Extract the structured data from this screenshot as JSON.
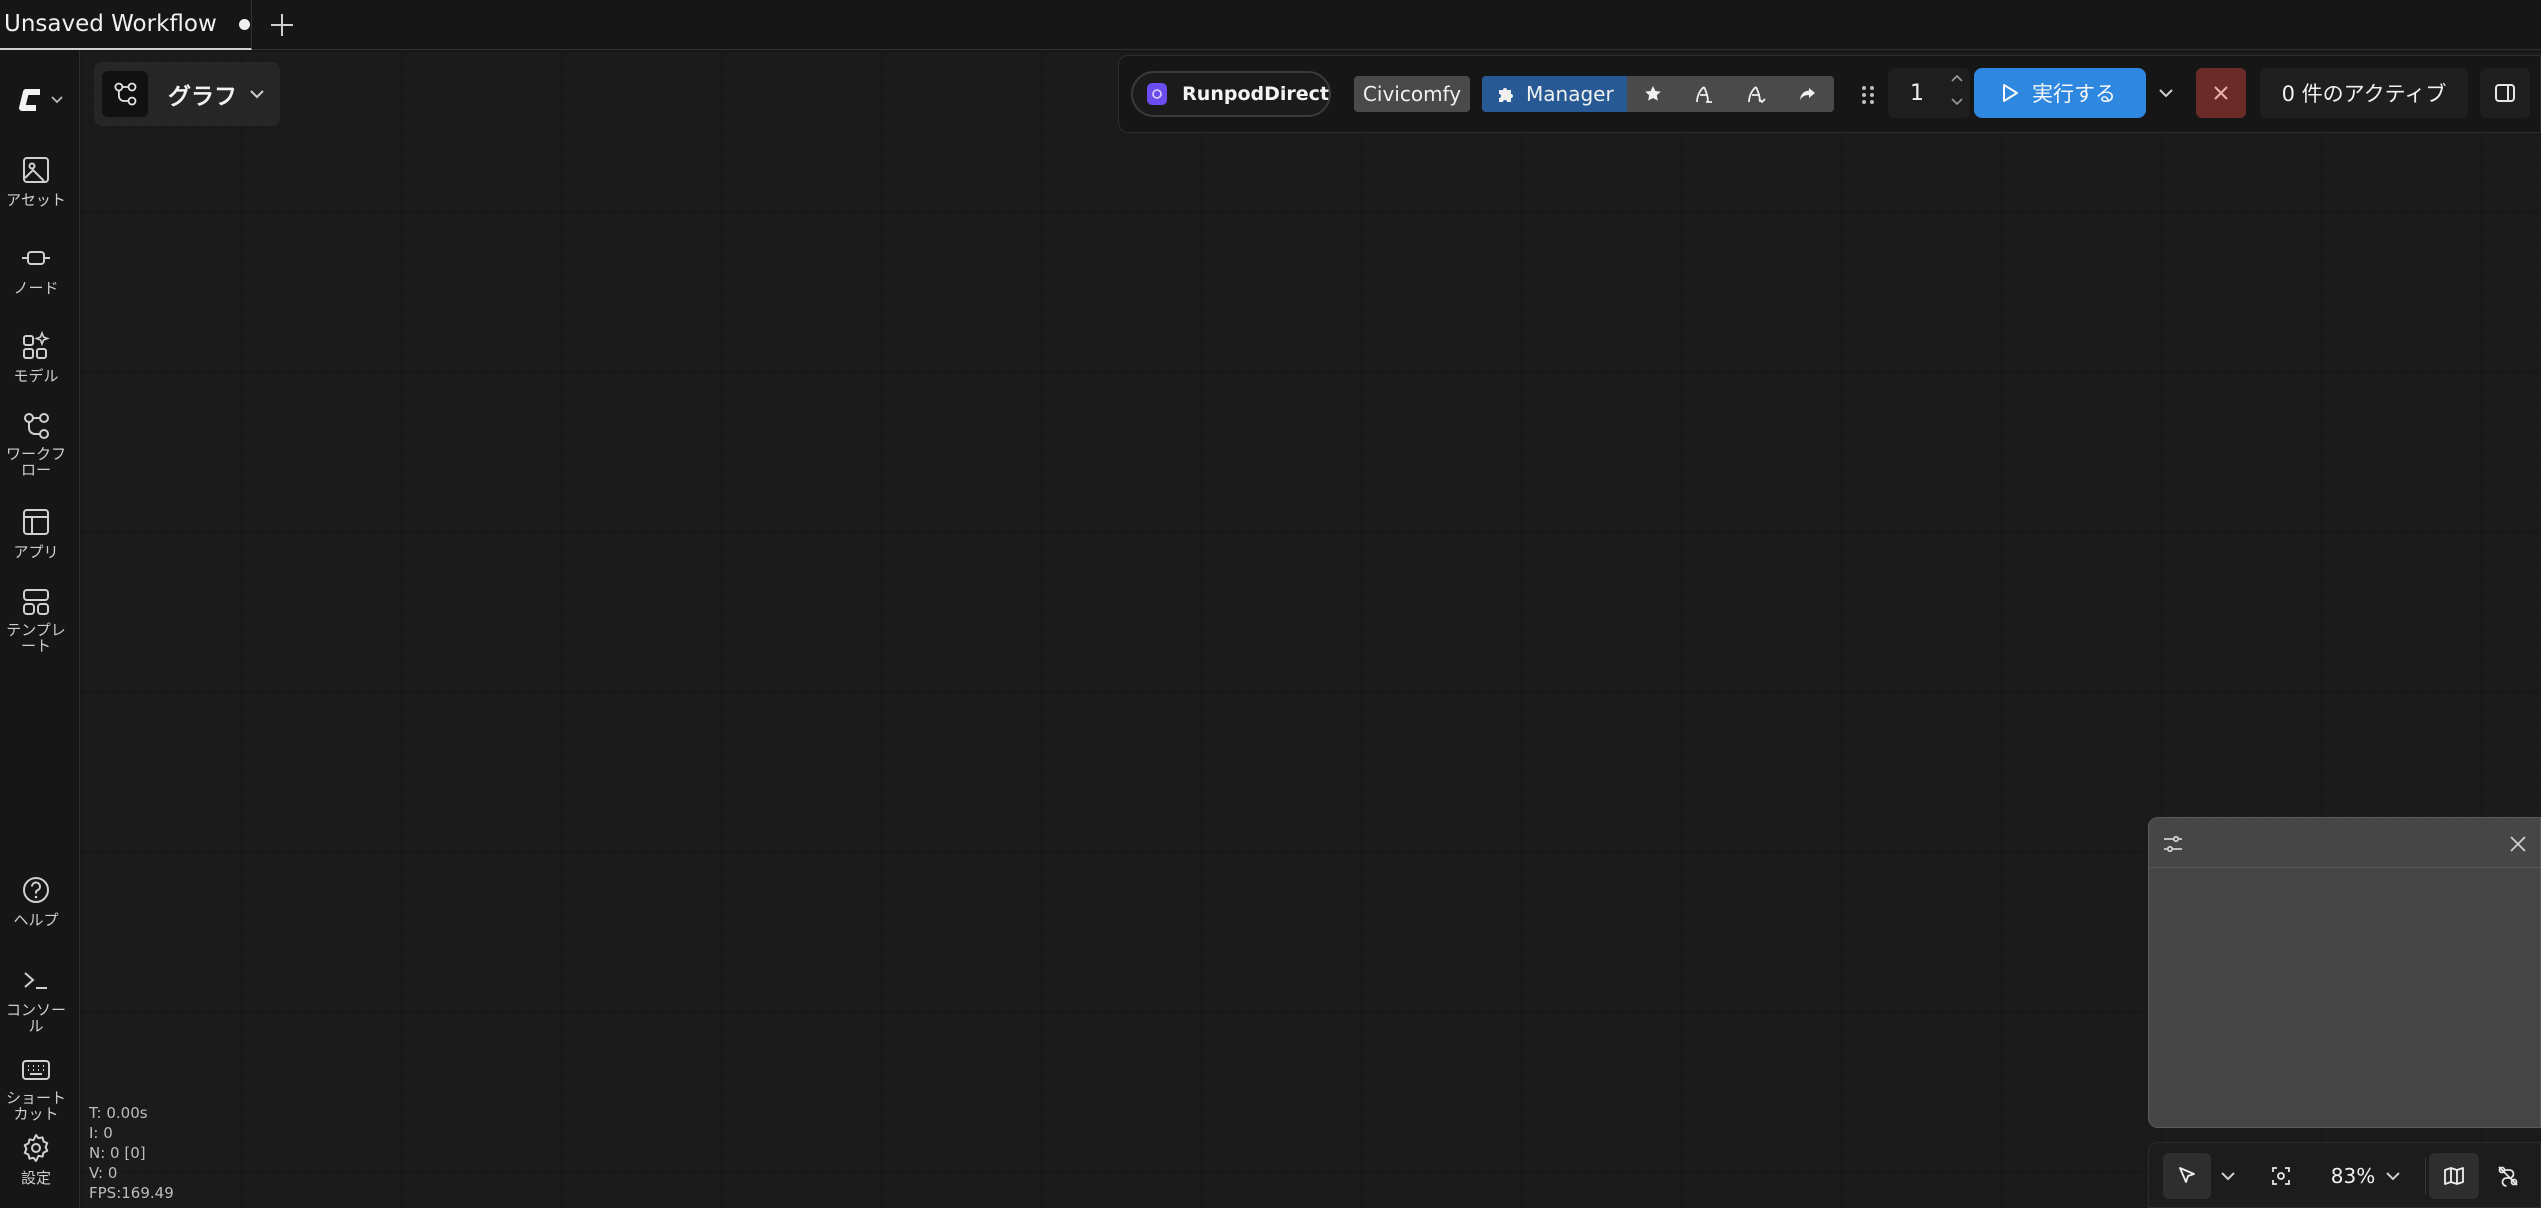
{
  "tabs": [
    {
      "title": "Unsaved Workflow",
      "modified": true
    }
  ],
  "new_tab_icon": "plus-icon",
  "sidebar": {
    "logo_icon": "comfy-logo-icon",
    "items": [
      {
        "label": "アセット",
        "icon": "image-icon"
      },
      {
        "label": "ノード",
        "icon": "node-icon"
      },
      {
        "label": "モデル",
        "icon": "model-icon"
      },
      {
        "label": "ワークフロー",
        "icon": "workflow-icon"
      },
      {
        "label": "アプリ",
        "icon": "app-icon"
      },
      {
        "label": "テンプレート",
        "icon": "template-icon"
      }
    ],
    "bottom_items": [
      {
        "label": "ヘルプ",
        "icon": "help-icon"
      },
      {
        "label": "コンソール",
        "icon": "console-icon"
      },
      {
        "label": "ショートカット",
        "icon": "keyboard-icon"
      },
      {
        "label": "設定",
        "icon": "settings-icon"
      }
    ]
  },
  "graph_selector": {
    "label": "グラフ"
  },
  "toolbar": {
    "runpod_label": "RunpodDirect",
    "civicomfy_label": "Civicomfy",
    "manager_label": "Manager",
    "batch_count": "1",
    "run_label": "実行する",
    "active_label": "0 件のアクティブ"
  },
  "canvas": {
    "zoom": "83%"
  },
  "stats": {
    "t": "T: 0.00s",
    "i": "I: 0",
    "n": "N: 0 [0]",
    "v": "V: 0",
    "fps": "FPS:169.49"
  },
  "colors": {
    "accent": "#2f88e0",
    "manager": "#275a94",
    "stop": "#6b2b29",
    "runpod": "#6a4cf0"
  }
}
